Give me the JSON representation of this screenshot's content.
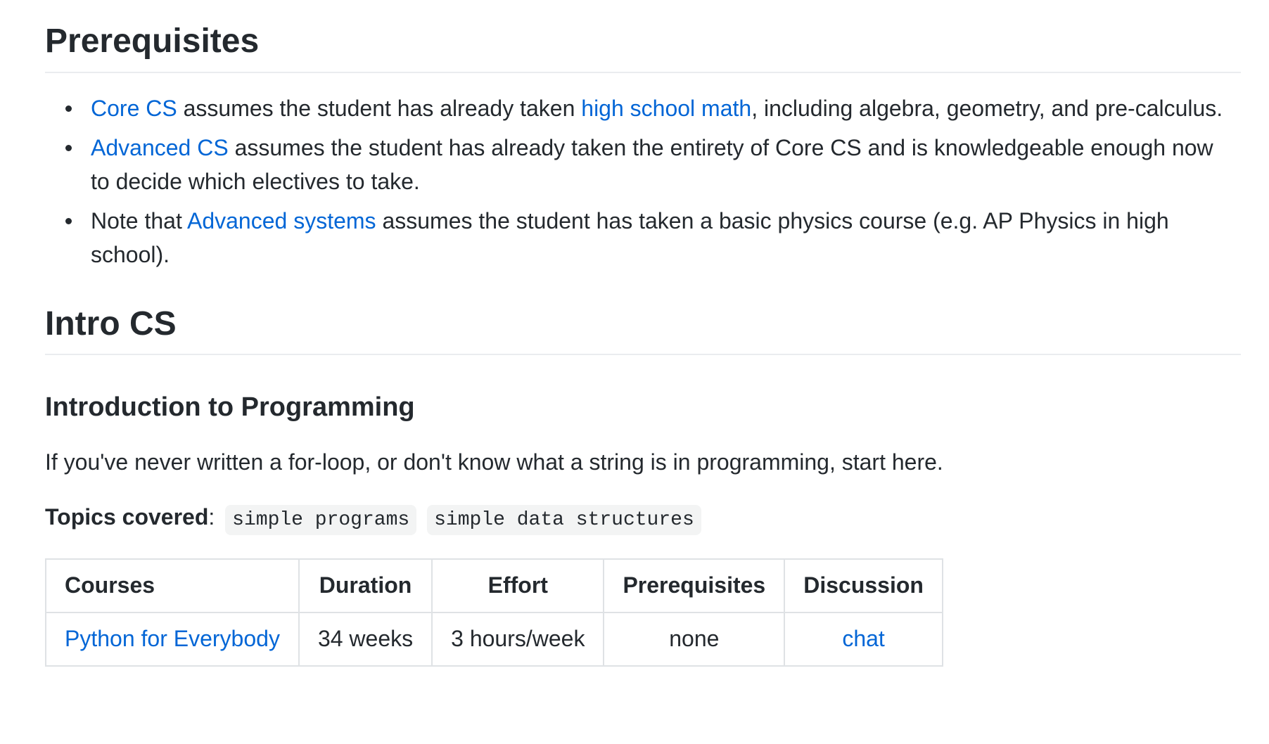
{
  "prerequisites": {
    "heading": "Prerequisites",
    "items": [
      {
        "link1": "Core CS",
        "text1": " assumes the student has already taken ",
        "link2": "high school math",
        "text2": ", including algebra, geometry, and pre-calculus."
      },
      {
        "link1": "Advanced CS",
        "text1": " assumes the student has already taken the entirety of Core CS and is knowledgeable enough now to decide which electives to take."
      },
      {
        "text0": "Note that ",
        "link1": "Advanced systems",
        "text1": " assumes the student has taken a basic physics course (e.g. AP Physics in high school)."
      }
    ]
  },
  "intro_cs": {
    "heading": "Intro CS",
    "subheading": "Introduction to Programming",
    "description": "If you've never written a for-loop, or don't know what a string is in programming, start here.",
    "topics_label": "Topics covered",
    "topics_colon": ":",
    "topics": [
      "simple programs",
      "simple data structures"
    ],
    "table": {
      "headers": [
        "Courses",
        "Duration",
        "Effort",
        "Prerequisites",
        "Discussion"
      ],
      "rows": [
        {
          "course": "Python for Everybody",
          "duration": "34 weeks",
          "effort": "3 hours/week",
          "prerequisites": "none",
          "discussion": "chat"
        }
      ]
    }
  },
  "colors": {
    "link": "#0366d6",
    "text": "#24292e",
    "rule": "#eaecef",
    "code_bg": "#f3f4f4",
    "table_border": "#dfe2e5"
  }
}
